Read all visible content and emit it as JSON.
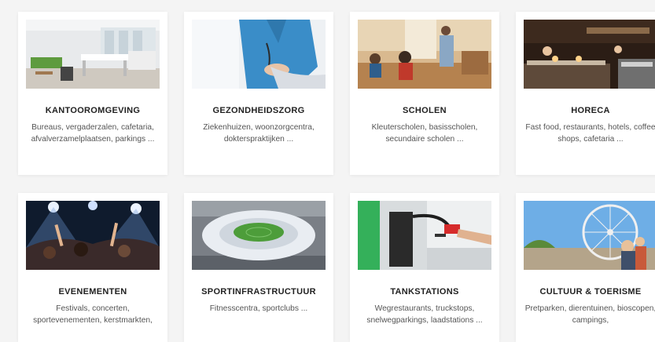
{
  "cards": [
    {
      "title": "KANTOOROMGEVING",
      "desc": "Bureaus, vergaderzalen, cafetaria, afvalverzamelplaatsen, parkings ..."
    },
    {
      "title": "GEZONDHEIDSZORG",
      "desc": "Ziekenhuizen, woonzorgcentra, dokterspraktijken ..."
    },
    {
      "title": "SCHOLEN",
      "desc": "Kleuterscholen, basisscholen, secundaire scholen ..."
    },
    {
      "title": "HORECA",
      "desc": "Fast food, restaurants, hotels, coffee shops, cafetaria ..."
    },
    {
      "title": "EVENEMENTEN",
      "desc": "Festivals, concerten, sportevenementen, kerstmarkten,"
    },
    {
      "title": "SPORTINFRASTRUCTUUR",
      "desc": "Fitnesscentra, sportclubs ..."
    },
    {
      "title": "TANKSTATIONS",
      "desc": "Wegrestaurants, truckstops, snelwegparkings, laadstations ..."
    },
    {
      "title": "CULTUUR & TOERISME",
      "desc": "Pretparken, dierentuinen, bioscopen, campings,"
    }
  ]
}
